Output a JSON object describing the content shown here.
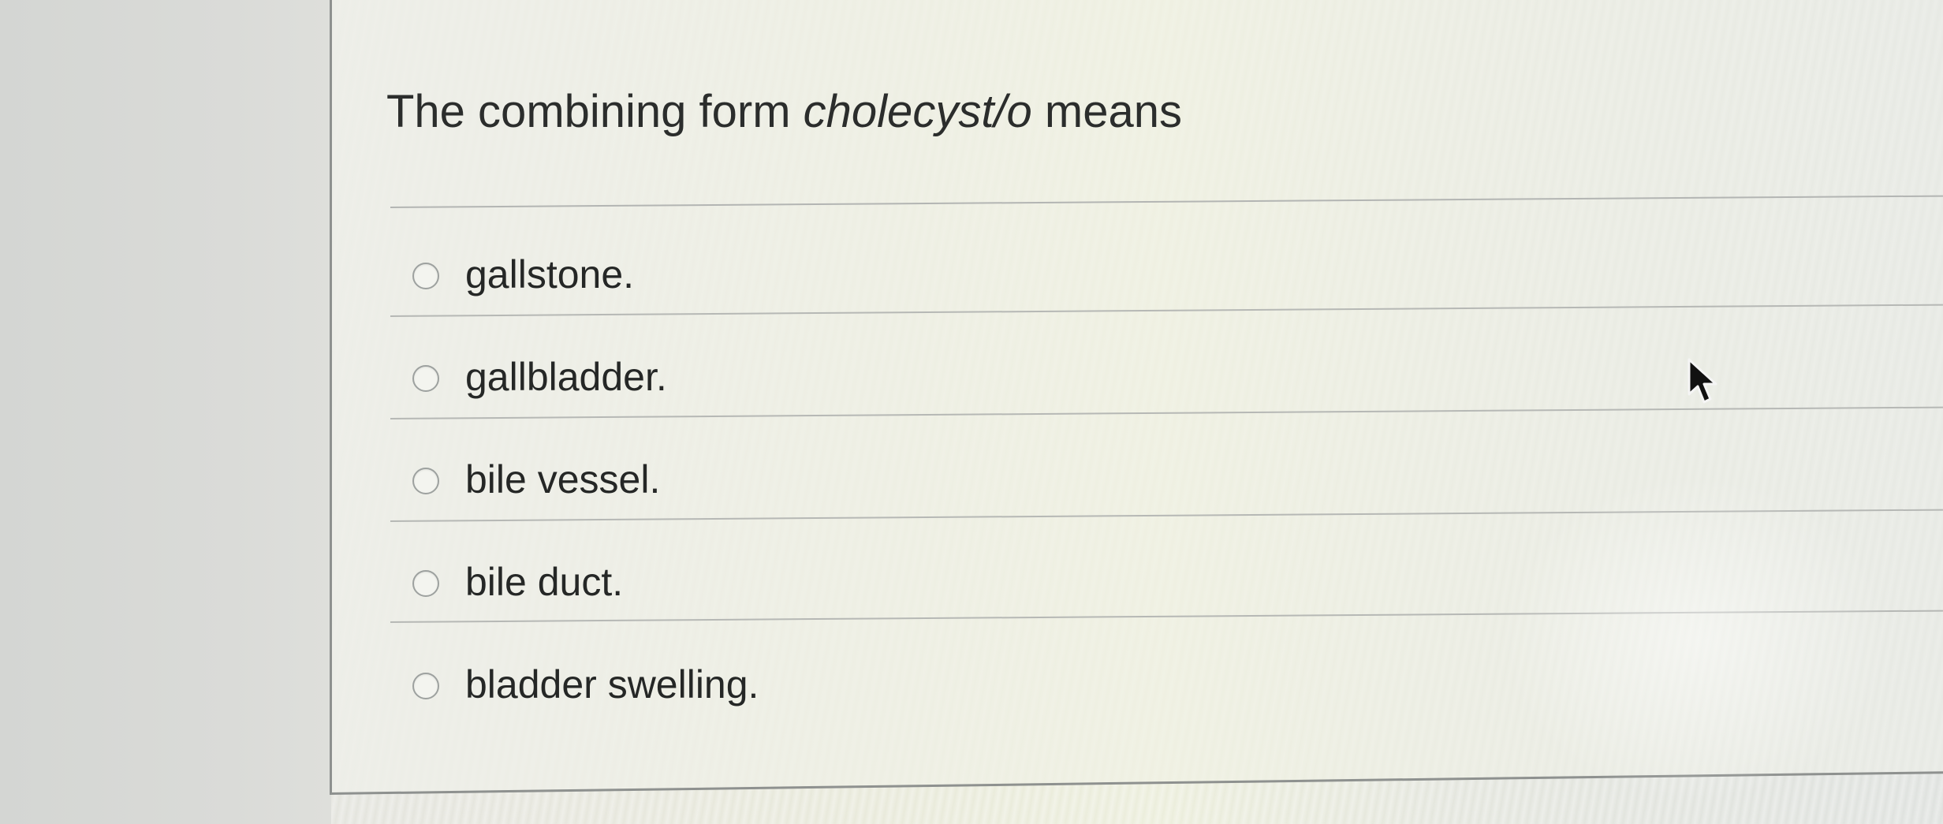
{
  "question": {
    "prefix": "The combining form ",
    "term": "cholecyst/o",
    "suffix": " means"
  },
  "options": [
    {
      "label": "gallstone.",
      "selected": false
    },
    {
      "label": "gallbladder.",
      "selected": false
    },
    {
      "label": "bile vessel.",
      "selected": false
    },
    {
      "label": "bile duct.",
      "selected": false
    },
    {
      "label": "bladder swelling.",
      "selected": false
    }
  ],
  "cursor": {
    "icon": "arrow-cursor-icon"
  }
}
